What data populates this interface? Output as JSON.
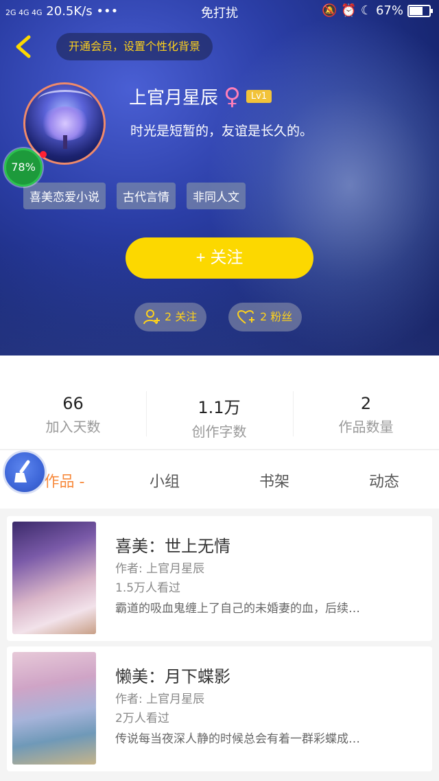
{
  "status_bar": {
    "signal": "2G 4G 4G",
    "speed": "20.5K/s",
    "dots": "•••",
    "mode": "免打扰",
    "battery": "67%",
    "battery_level": 0.67
  },
  "header": {
    "vip_prompt": "开通会员，设置个性化背景",
    "username": "上官月星辰",
    "gender_symbol": "♀",
    "level": "Lv1",
    "signature": "时光是短暂的，友谊是长久的。",
    "progress": "78%",
    "tags": [
      "喜美恋爱小说",
      "古代言情",
      "非同人文"
    ],
    "follow_label": "+  关注",
    "following": "2 关注",
    "fans": "2 粉丝"
  },
  "stats": [
    {
      "value": "66",
      "label": "加入天数"
    },
    {
      "value": "1.1万",
      "label": "创作字数"
    },
    {
      "value": "2",
      "label": "作品数量"
    }
  ],
  "tabs": [
    "作品 -",
    "小组",
    "书架",
    "动态"
  ],
  "books": [
    {
      "title": "喜美：世上无情",
      "author": "作者: 上官月星辰",
      "views": "1.5万人看过",
      "desc": "霸道的吸血鬼缠上了自己的未婚妻的血，后续…"
    },
    {
      "title": "懒美：月下蝶影",
      "author": "作者: 上官月星辰",
      "views": "2万人看过",
      "desc": "传说每当夜深人静的时候总会有着一群彩蝶成…"
    }
  ],
  "colors": {
    "accent_yellow": "#fcd800",
    "active_tab": "#f7893b",
    "progress_green": "#1d9a3b"
  }
}
